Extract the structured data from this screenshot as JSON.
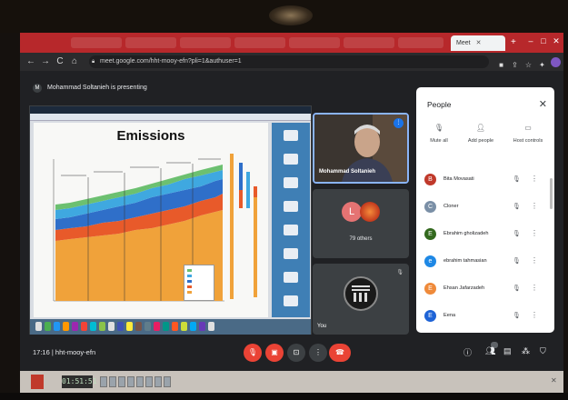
{
  "browser": {
    "active_tab_label": "Meet",
    "url": "meet.google.com/hht-mooy-efn?pli=1&authuser=1"
  },
  "meet": {
    "presenting_banner": "Mohammad Soltanieh is presenting",
    "presenter_initial": "M",
    "presenter_name": "Mohammad Soltanieh",
    "others_initial": "L",
    "others_count": "79 others",
    "you_label": "You",
    "time": "17:16",
    "separator": "|",
    "meeting_code": "hht-mooy-efn"
  },
  "slide": {
    "title": "Emissions"
  },
  "people_panel": {
    "title": "People",
    "actions": [
      {
        "label": "Mute all",
        "icon": "mic-off-icon"
      },
      {
        "label": "Add people",
        "icon": "person-add-icon"
      },
      {
        "label": "Host controls",
        "icon": "host-controls-icon"
      }
    ],
    "participants": [
      {
        "initial": "B",
        "name": "Bita Movasati",
        "color": "#c0392b"
      },
      {
        "initial": "C",
        "name": "Cloner",
        "color": "#7a8fa6"
      },
      {
        "initial": "E",
        "name": "Ebrahim gholizadeh",
        "color": "#33691e"
      },
      {
        "initial": "e",
        "name": "ebrahim tahmasian",
        "color": "#1e88e5"
      },
      {
        "initial": "E",
        "name": "Ehsan Jafarzadeh",
        "color": "#ef8a3a"
      },
      {
        "initial": "E",
        "name": "Eena",
        "color": "#1e63d6"
      }
    ]
  },
  "taskbar": {
    "clock": "01:51:51"
  },
  "colors": {
    "meet_bg": "#202124",
    "accent_red": "#ea4335",
    "tab_strip": "#b7282b"
  }
}
